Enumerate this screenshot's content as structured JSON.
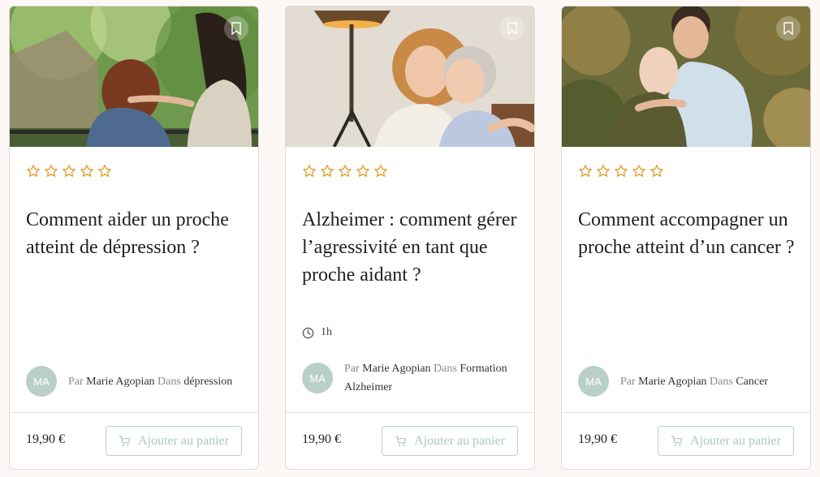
{
  "colors": {
    "accent_star": "#e0a030",
    "avatar_bg": "#b9d0c6",
    "button_border": "#b9d3c8",
    "button_text": "#a9c9bc"
  },
  "icons": {
    "bookmark": "bookmark-icon",
    "star": "star-outline-icon",
    "clock": "clock-icon",
    "cart": "cart-icon"
  },
  "cards": [
    {
      "rating_stars": 0,
      "title": "Comment aider un proche atteint de dépression ?",
      "duration": "",
      "author": {
        "initials": "MA",
        "by_label": "Par",
        "name": "Marie Agopian",
        "in_label": "Dans",
        "category": "dépression"
      },
      "price": "19,90 €",
      "button_label": "Ajouter au panier"
    },
    {
      "rating_stars": 0,
      "title": "Alzheimer : comment gérer l’agressivité en tant que proche aidant ?",
      "duration": "1h",
      "author": {
        "initials": "MA",
        "by_label": "Par",
        "name": "Marie Agopian",
        "in_label": "Dans",
        "category": "Formation Alzheimer"
      },
      "price": "19,90 €",
      "button_label": "Ajouter au panier"
    },
    {
      "rating_stars": 0,
      "title": "Comment accompagner un proche atteint d’un cancer ?",
      "duration": "",
      "author": {
        "initials": "MA",
        "by_label": "Par",
        "name": "Marie Agopian",
        "in_label": "Dans",
        "category": "Cancer"
      },
      "price": "19,90 €",
      "button_label": "Ajouter au panier"
    }
  ]
}
